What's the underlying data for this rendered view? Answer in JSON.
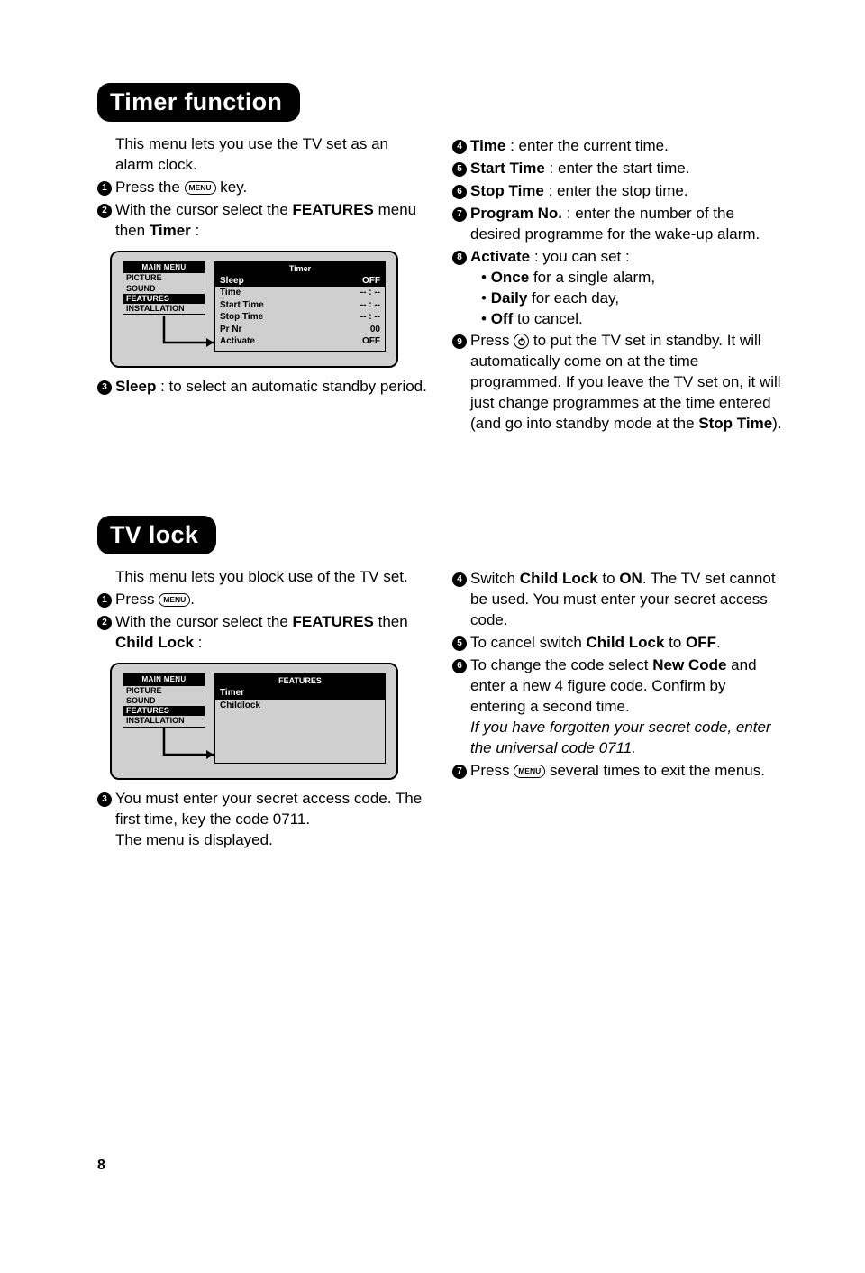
{
  "page_number": "8",
  "sections": {
    "timer": {
      "heading": "Timer function",
      "intro": "This menu lets you use the TV set as an alarm clock.",
      "steps_left": {
        "s1_a": "Press the ",
        "s1_key": "MENU",
        "s1_b": " key.",
        "s2_a": "With the cursor select the ",
        "s2_b": "FEATURES",
        "s2_c": " menu then ",
        "s2_d": "Timer",
        "s2_e": " :",
        "s3_a": "Sleep",
        "s3_b": " : to select an automatic standby period."
      },
      "osd": {
        "main_title": "MAIN MENU",
        "main_items": [
          "PICTURE",
          "SOUND",
          "FEATURES",
          "INSTALLATION"
        ],
        "main_selected_index": 2,
        "sub_title": "Timer",
        "sub_rows": [
          {
            "label": "Sleep",
            "value": "OFF",
            "sel": true
          },
          {
            "label": "Time",
            "value": "-- : --"
          },
          {
            "label": "Start Time",
            "value": "-- : --"
          },
          {
            "label": "Stop Time",
            "value": "-- : --"
          },
          {
            "label": "Pr Nr",
            "value": "00"
          },
          {
            "label": "Activate",
            "value": "OFF"
          }
        ]
      },
      "steps_right": {
        "s4_a": "Time",
        "s4_b": " : enter the current time.",
        "s5_a": "Start Time",
        "s5_b": " : enter the start time.",
        "s6_a": "Stop Time",
        "s6_b": " : enter the stop time.",
        "s7_a": "Program No.",
        "s7_b": " : enter the number of the desired programme for the wake-up alarm.",
        "s8_a": "Activate",
        "s8_b": " : you can set :",
        "s8_once_a": "Once",
        "s8_once_b": " for a single alarm,",
        "s8_daily_a": "Daily",
        "s8_daily_b": " for each day,",
        "s8_off_a": "Off",
        "s8_off_b": " to cancel.",
        "s9_a": "Press ",
        "s9_b": " to put the TV set in standby.",
        "s9_c": "It will automatically come on at the time programmed. If you leave the TV set on, it will just change programmes at the time entered (and go into standby mode at the ",
        "s9_d": "Stop Time",
        "s9_e": ")."
      }
    },
    "tvlock": {
      "heading": "TV lock",
      "intro": "This menu lets you block use of the TV set.",
      "steps_left": {
        "s1_a": "Press ",
        "s1_key": "MENU",
        "s1_b": ".",
        "s2_a": "With the cursor select the ",
        "s2_b": "FEATURES",
        "s2_c": " then ",
        "s2_d": "Child Lock",
        "s2_e": " :",
        "s3_a": "You must enter your secret access code. The first time, key the code 0711.",
        "s3_b": "The menu is displayed."
      },
      "osd": {
        "main_title": "MAIN MENU",
        "main_items": [
          "PICTURE",
          "SOUND",
          "FEATURES",
          "INSTALLATION"
        ],
        "main_selected_index": 2,
        "sub_title": "FEATURES",
        "sub_rows": [
          {
            "label": "Timer",
            "value": "",
            "sel": true
          },
          {
            "label": "Childlock",
            "value": ""
          }
        ]
      },
      "steps_right": {
        "s4_a": "Switch ",
        "s4_b": "Child Lock",
        "s4_c": " to ",
        "s4_d": "ON",
        "s4_e": ". The TV set cannot be used. You must enter your secret access code.",
        "s5_a": "To cancel switch ",
        "s5_b": "Child Lock",
        "s5_c": " to ",
        "s5_d": "OFF",
        "s5_e": ".",
        "s6_a": "To change the code select ",
        "s6_b": "New Code",
        "s6_c": " and enter a new 4 figure code. Confirm by entering a second time.",
        "s6_note": "If you have forgotten your secret code, enter the universal code 0711.",
        "s7_a": "Press ",
        "s7_key": "MENU",
        "s7_b": " several times to exit the menus."
      }
    }
  }
}
